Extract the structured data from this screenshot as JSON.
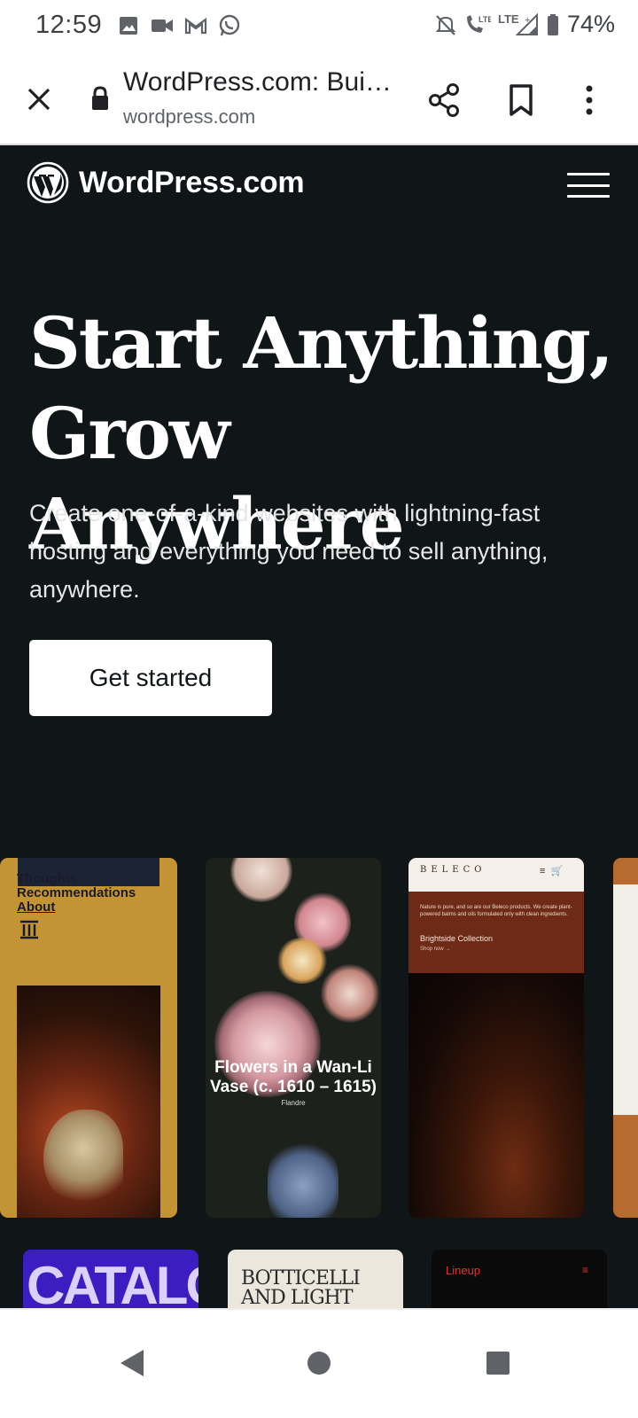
{
  "status_bar": {
    "time": "12:59",
    "battery": "74%",
    "lte_label": "LTE",
    "icons_left": [
      "gallery-icon",
      "video-icon",
      "gmail-icon",
      "whatsapp-icon"
    ],
    "icons_right": [
      "mute-icon",
      "lte-call-icon",
      "signal-icon",
      "battery-icon"
    ]
  },
  "toolbar": {
    "page_title": "WordPress.com: Bui…",
    "url": "wordpress.com"
  },
  "site": {
    "logo_text": "WordPress.com",
    "hero_title_line1": "Start Anything,",
    "hero_title_line2": "Grow Anywhere",
    "hero_subtitle": "Create one-of-a-kind websites with lightning-fast hosting and everything you need to sell anything, anywhere.",
    "cta_label": "Get started"
  },
  "gallery": {
    "card1": {
      "lines": [
        "Thoughts",
        "Recommendations",
        "About"
      ]
    },
    "card2": {
      "caption_line1": "Flowers in a Wan-Li",
      "caption_line2": "Vase (c. 1610 – 1615)",
      "small_text": "Flandre"
    },
    "card3": {
      "brand": "BELECO",
      "tagline": "Nature is pure, and so are our Beleco products. We create plant-powered balms and oils formulated only with clean ingredients.",
      "collection": "Brightside Collection",
      "shop": "Shop now →"
    },
    "card5": {
      "text": "CATALOG"
    },
    "card6": {
      "line1": "BOTTICELLI",
      "line2": "AND LIGHT"
    },
    "card7": {
      "text": "Lineup"
    }
  },
  "colors": {
    "site_background": "#101517",
    "cta_background": "#ffffff",
    "card1_background": "#c39433",
    "card3_band": "#6d2a16",
    "card5_background": "#3b1dc2",
    "card7_accent": "#e4342c"
  }
}
